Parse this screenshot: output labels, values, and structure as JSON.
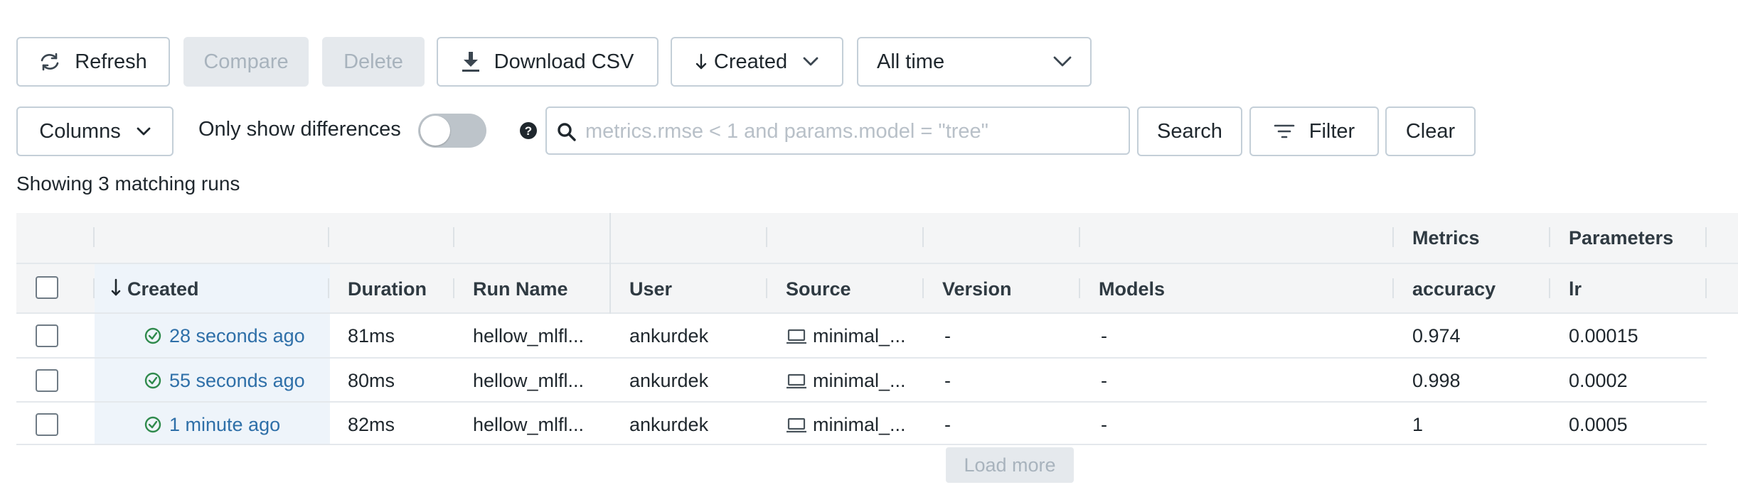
{
  "toolbar": {
    "refresh": "Refresh",
    "compare": "Compare",
    "delete": "Delete",
    "download_csv": "Download CSV",
    "sort": "Created",
    "time_range": "All time"
  },
  "filterbar": {
    "columns": "Columns",
    "only_show_differences": "Only show differences",
    "search_placeholder": "metrics.rmse < 1 and params.model = \"tree\"",
    "search_value": "",
    "search_button": "Search",
    "filter_button": "Filter",
    "clear_button": "Clear"
  },
  "summary": "Showing 3 matching runs",
  "table": {
    "groups": {
      "metrics": "Metrics",
      "parameters": "Parameters"
    },
    "columns": {
      "created": "Created",
      "duration": "Duration",
      "run_name": "Run Name",
      "user": "User",
      "source": "Source",
      "version": "Version",
      "models": "Models",
      "accuracy": "accuracy",
      "lr": "lr"
    },
    "rows": [
      {
        "created": "28 seconds ago",
        "duration": "81ms",
        "run_name": "hellow_mlfl...",
        "user": "ankurdek",
        "source": "minimal_...",
        "version": "-",
        "models": "-",
        "accuracy": "0.974",
        "lr": "0.00015"
      },
      {
        "created": "55 seconds ago",
        "duration": "80ms",
        "run_name": "hellow_mlfl...",
        "user": "ankurdek",
        "source": "minimal_...",
        "version": "-",
        "models": "-",
        "accuracy": "0.998",
        "lr": "0.0002"
      },
      {
        "created": "1 minute ago",
        "duration": "82ms",
        "run_name": "hellow_mlfl...",
        "user": "ankurdek",
        "source": "minimal_...",
        "version": "-",
        "models": "-",
        "accuracy": "1",
        "lr": "0.0005"
      }
    ]
  },
  "load_more": "Load more",
  "colors": {
    "link": "#2e6fa8",
    "success": "#2f8a4c",
    "border": "#c4cfd8",
    "disabled_bg": "#e5e9ed"
  },
  "icons": [
    "refresh-icon",
    "download-icon",
    "arrow-down-icon",
    "chevron-down-icon",
    "help-icon",
    "search-icon",
    "filter-icon",
    "check-circle-icon",
    "laptop-icon"
  ]
}
